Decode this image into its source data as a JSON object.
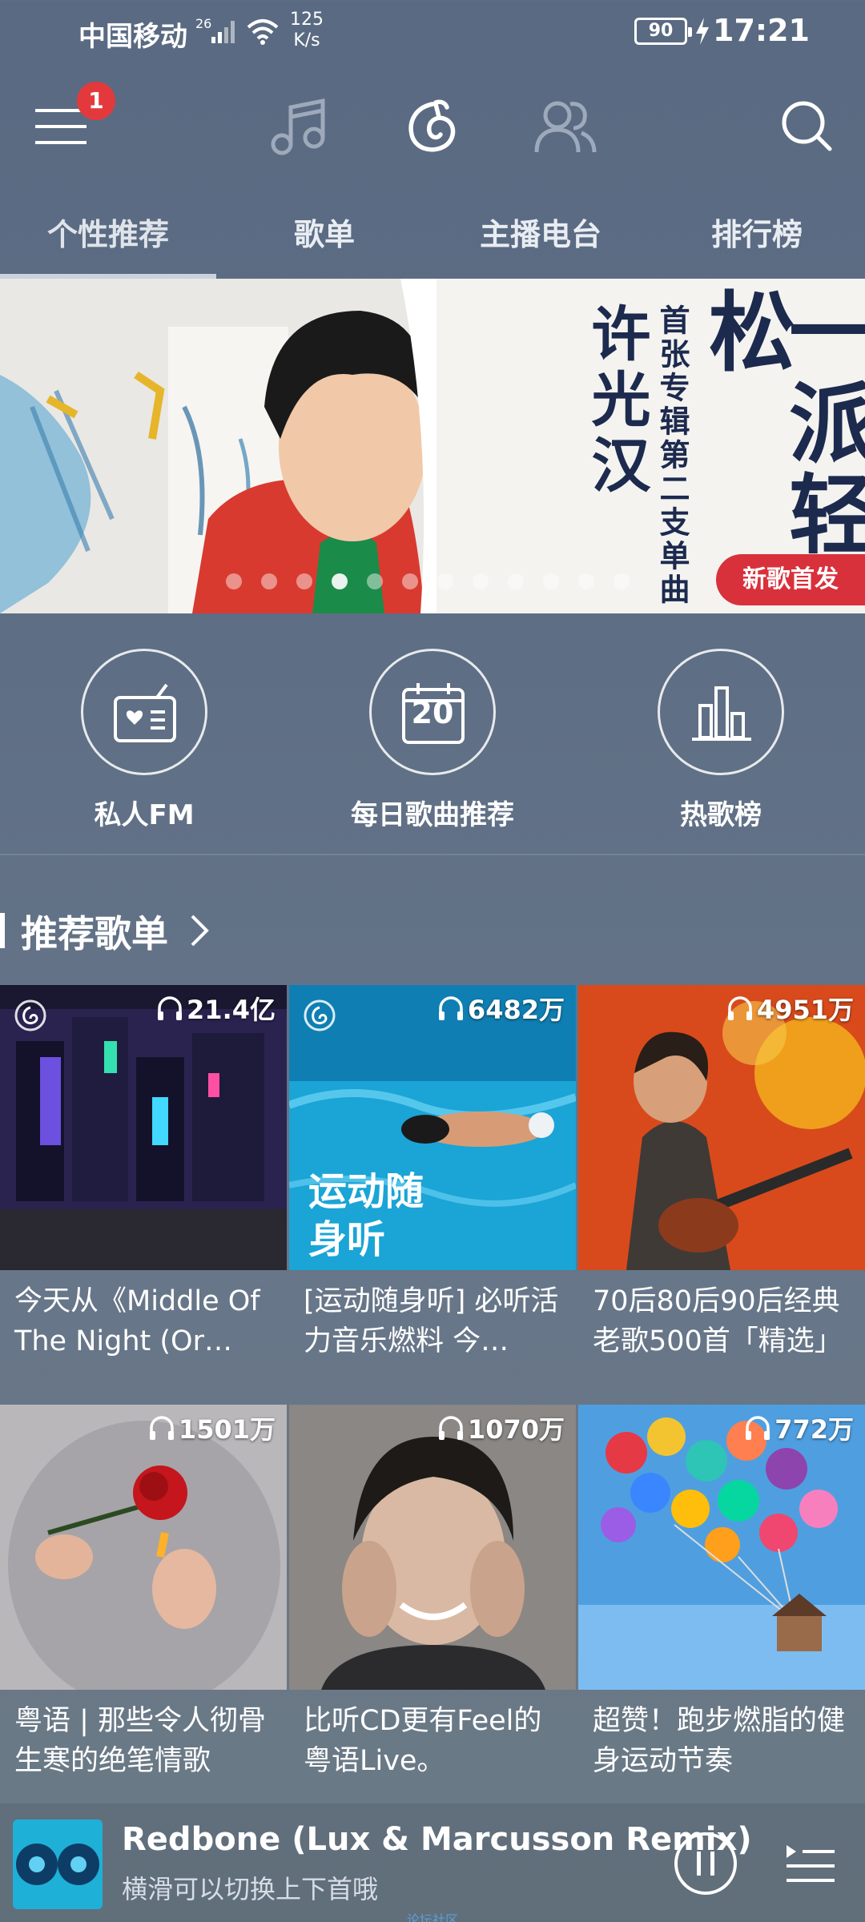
{
  "status_bar": {
    "carrier": "中国移动",
    "network": "26",
    "speed_value": "125",
    "speed_unit": "K/s",
    "battery": "90",
    "time": "17:21"
  },
  "top_nav": {
    "menu_badge": "1",
    "icons": [
      "menu-icon",
      "music-note-icon",
      "netease-logo-icon",
      "friends-icon",
      "search-icon"
    ]
  },
  "tabs": [
    "个性推荐",
    "歌单",
    "主播电台",
    "排行榜"
  ],
  "active_tab": 0,
  "banner": {
    "artist": "许光汉",
    "subtitle": "首张专辑第二支单曲",
    "song": "一派轻松",
    "tag": "新歌首发",
    "dots": 12,
    "active_dot": 3
  },
  "quick_entries": [
    {
      "label": "私人FM",
      "icon": "radio-icon"
    },
    {
      "label": "每日歌曲推荐",
      "icon": "calendar-icon",
      "day": "20"
    },
    {
      "label": "热歌榜",
      "icon": "chart-bars-icon"
    }
  ],
  "section": {
    "title": "推荐歌单"
  },
  "playlists": [
    {
      "count": "21.4亿",
      "caption": "今天从《Middle Of The Night (Or…"
    },
    {
      "count": "6482万",
      "caption": "[运动随身听] 必听活力音乐燃料 今…",
      "cover_text": "运动随身听"
    },
    {
      "count": "4951万",
      "caption": "70后80后90后经典老歌500首「精选」"
    },
    {
      "count": "1501万",
      "caption": "粤语 | 那些令人彻骨生寒的绝笔情歌"
    },
    {
      "count": "1070万",
      "caption": "比听CD更有Feel的粤语Live。"
    },
    {
      "count": "772万",
      "caption": "超赞！跑步燃脂的健身运动节奏"
    }
  ],
  "player": {
    "title": "Redbone (Lux & Marcusson Remix)",
    "subtitle": "横滑可以切换上下首哦"
  },
  "footer_note": "论坛社区",
  "colors": {
    "background": "#5d6d84",
    "accent_red": "#d8313c",
    "badge_red": "#e4393c"
  }
}
